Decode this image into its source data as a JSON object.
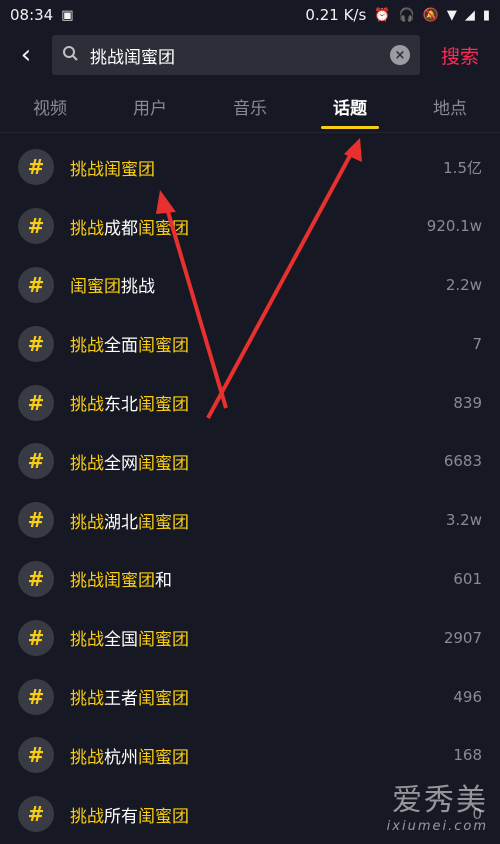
{
  "status_bar": {
    "time": "08:34",
    "speed": "0.21 K/s",
    "icons": [
      "image-icon",
      "alarm-icon",
      "headset-icon",
      "mute-icon",
      "wifi-icon",
      "signal-icon",
      "battery-icon"
    ]
  },
  "search": {
    "query": "挑战闺蜜团",
    "submit_label": "搜索"
  },
  "tabs": [
    {
      "label": "视频"
    },
    {
      "label": "用户"
    },
    {
      "label": "音乐"
    },
    {
      "label": "话题",
      "active": true
    },
    {
      "label": "地点"
    }
  ],
  "topics": [
    {
      "segments": [
        {
          "t": "挑战闺蜜团",
          "h": true
        }
      ],
      "count": "1.5亿"
    },
    {
      "segments": [
        {
          "t": "挑战",
          "h": true
        },
        {
          "t": "成都",
          "h": false
        },
        {
          "t": "闺蜜团",
          "h": true
        }
      ],
      "count": "920.1w"
    },
    {
      "segments": [
        {
          "t": "闺蜜团",
          "h": true
        },
        {
          "t": "挑战",
          "h": false
        }
      ],
      "count": "2.2w"
    },
    {
      "segments": [
        {
          "t": "挑战",
          "h": true
        },
        {
          "t": "全面",
          "h": false
        },
        {
          "t": "闺蜜团",
          "h": true
        }
      ],
      "count": "7"
    },
    {
      "segments": [
        {
          "t": "挑战",
          "h": true
        },
        {
          "t": "东北",
          "h": false
        },
        {
          "t": "闺蜜团",
          "h": true
        }
      ],
      "count": "839"
    },
    {
      "segments": [
        {
          "t": "挑战",
          "h": true
        },
        {
          "t": "全网",
          "h": false
        },
        {
          "t": "闺蜜团",
          "h": true
        }
      ],
      "count": "6683"
    },
    {
      "segments": [
        {
          "t": "挑战",
          "h": true
        },
        {
          "t": "湖北",
          "h": false
        },
        {
          "t": "闺蜜团",
          "h": true
        }
      ],
      "count": "3.2w"
    },
    {
      "segments": [
        {
          "t": "挑战闺蜜团",
          "h": true
        },
        {
          "t": "和",
          "h": false
        }
      ],
      "count": "601"
    },
    {
      "segments": [
        {
          "t": "挑战",
          "h": true
        },
        {
          "t": "全国",
          "h": false
        },
        {
          "t": "闺蜜团",
          "h": true
        }
      ],
      "count": "2907"
    },
    {
      "segments": [
        {
          "t": "挑战",
          "h": true
        },
        {
          "t": "王者",
          "h": false
        },
        {
          "t": "闺蜜团",
          "h": true
        }
      ],
      "count": "496"
    },
    {
      "segments": [
        {
          "t": "挑战",
          "h": true
        },
        {
          "t": "杭州",
          "h": false
        },
        {
          "t": "闺蜜团",
          "h": true
        }
      ],
      "count": "168"
    },
    {
      "segments": [
        {
          "t": "挑战",
          "h": true
        },
        {
          "t": "所有",
          "h": false
        },
        {
          "t": "闺蜜团",
          "h": true
        }
      ],
      "count": "0"
    }
  ],
  "watermark": {
    "cn": "爱秀美",
    "en": "ixiumei.com"
  },
  "colors": {
    "background": "#161823",
    "highlight": "#face15",
    "accent_red": "#fe2c55",
    "annotation_arrow": "#e8312f"
  }
}
